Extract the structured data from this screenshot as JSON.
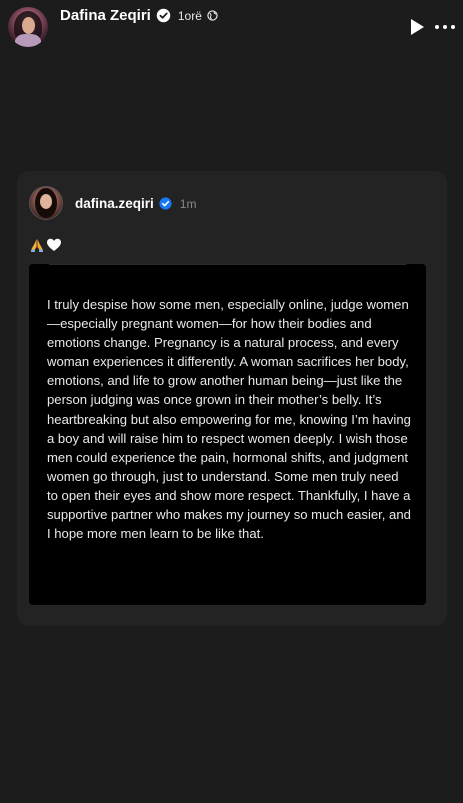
{
  "header": {
    "name": "Dafina Zeqiri",
    "time": "1orë",
    "icons": [
      "verified-badge-icon",
      "globe-icon",
      "play-icon",
      "more-icon"
    ]
  },
  "post": {
    "author": "dafina.zeqiri",
    "time": "1m",
    "emojis": "🙏🤍",
    "body": "I truly despise how some men, especially online, judge women—especially pregnant women—for how their bodies and emotions change. Pregnancy is a natural process, and every woman experiences it differently. A woman sacrifices her body, emotions, and life to grow another human being—just like the person judging was once grown in their mother’s belly. It’s heartbreaking but also empowering for me, knowing I’m having a boy and will raise him to respect women deeply. I wish those men could experience the pain, hormonal shifts, and judgment women go through, just to understand. Some men truly need to open their eyes and show more respect. Thankfully, I have a supportive partner who makes my journey so much easier, and I hope more men learn to be like that."
  },
  "colors": {
    "background": "#1c1c1c",
    "card": "#232323",
    "verified": "#1877f2"
  }
}
